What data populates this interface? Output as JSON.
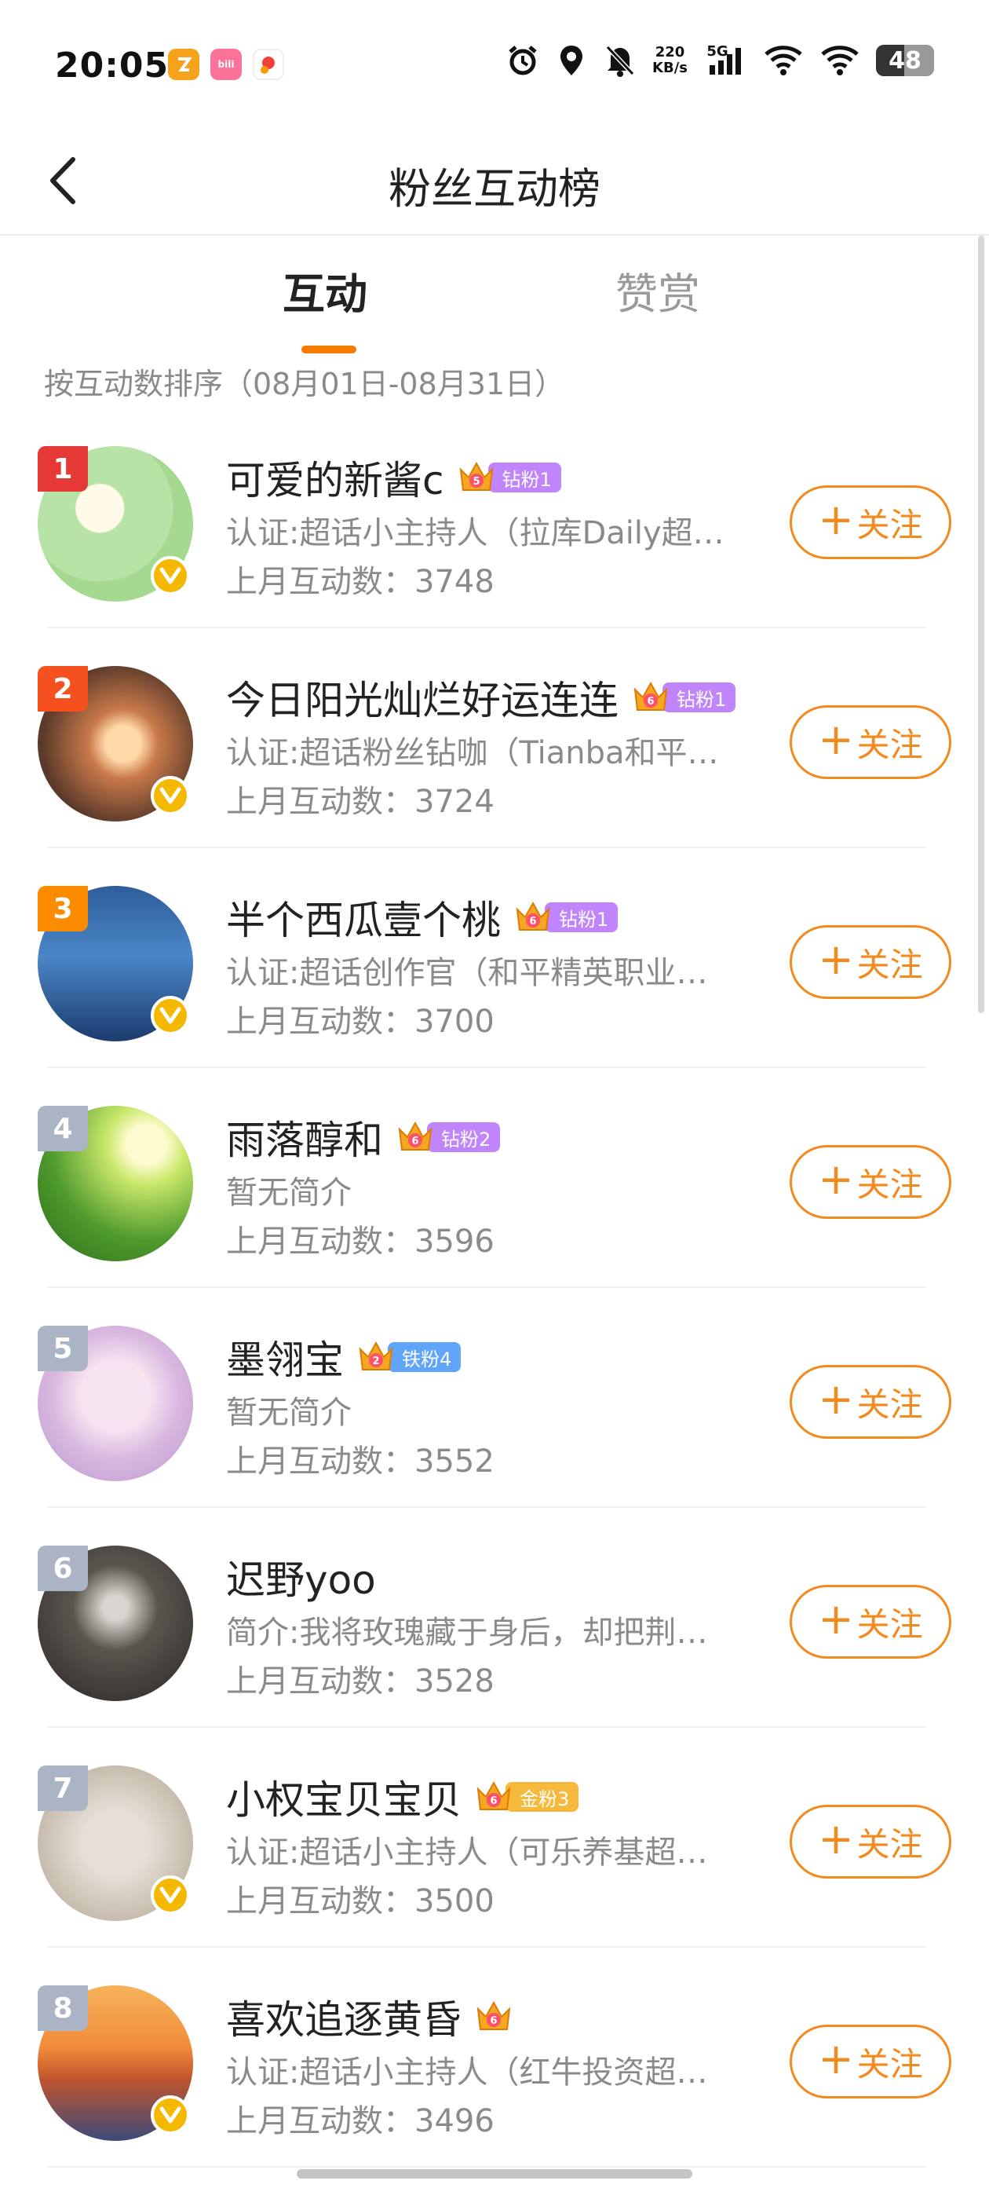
{
  "status_bar": {
    "time": "20:05",
    "net_speed_value": "220",
    "net_speed_unit": "KB/s",
    "network": "5G",
    "battery": "48",
    "icons": [
      "alarm-icon",
      "location-icon",
      "mute-icon",
      "signal-icon",
      "wifi-icon",
      "wifi-icon",
      "battery-icon"
    ],
    "app_icons": [
      "app-icon",
      "bilibili-icon",
      "app-icon"
    ]
  },
  "nav": {
    "title": "粉丝互动榜"
  },
  "tabs": [
    {
      "label": "互动",
      "active": true
    },
    {
      "label": "赞赏",
      "active": false
    }
  ],
  "sort_label": "按互动数排序（08月01日-08月31日）",
  "colors": {
    "accent": "#f57c00",
    "follow": "#f28a1e",
    "verified": "#f5b800"
  },
  "follow_label": "关注",
  "users": [
    {
      "rank": "1",
      "name": "可爱的新酱c",
      "crown_level": "5",
      "badge": "钻粉1",
      "badge_color": "#c084fc",
      "desc": "认证:超话小主持人（拉库Daily超…",
      "count": "上月互动数：3748",
      "verified": true
    },
    {
      "rank": "2",
      "name": "今日阳光灿烂好运连连",
      "crown_level": "6",
      "badge": "钻粉1",
      "badge_color": "#c084fc",
      "desc": "认证:超话粉丝钻咖（Tianba和平…",
      "count": "上月互动数：3724",
      "verified": true
    },
    {
      "rank": "3",
      "name": "半个西瓜壹个桃",
      "crown_level": "6",
      "badge": "钻粉1",
      "badge_color": "#c084fc",
      "desc": "认证:超话创作官（和平精英职业…",
      "count": "上月互动数：3700",
      "verified": true
    },
    {
      "rank": "4",
      "name": "雨落醇和",
      "crown_level": "6",
      "badge": "钻粉2",
      "badge_color": "#c084fc",
      "desc": "暂无简介",
      "count": "上月互动数：3596",
      "verified": false
    },
    {
      "rank": "5",
      "name": "墨翎宝",
      "crown_level": "2",
      "badge": "铁粉4",
      "badge_color": "#60a5fa",
      "desc": "暂无简介",
      "count": "上月互动数：3552",
      "verified": false
    },
    {
      "rank": "6",
      "name": "迟野yoo",
      "crown_level": "",
      "badge": "",
      "badge_color": "",
      "desc": "简介:我将玫瑰藏于身后，却把荆…",
      "count": "上月互动数：3528",
      "verified": false
    },
    {
      "rank": "7",
      "name": "小权宝贝宝贝",
      "crown_level": "6",
      "badge": "金粉3",
      "badge_color": "#f6b93b",
      "desc": "认证:超话小主持人（可乐养基超…",
      "count": "上月互动数：3500",
      "verified": true
    },
    {
      "rank": "8",
      "name": "喜欢追逐黄昏",
      "crown_level": "6",
      "badge": "",
      "badge_color": "",
      "desc": "认证:超话小主持人（红牛投资超…",
      "count": "上月互动数：3496",
      "verified": true
    }
  ]
}
